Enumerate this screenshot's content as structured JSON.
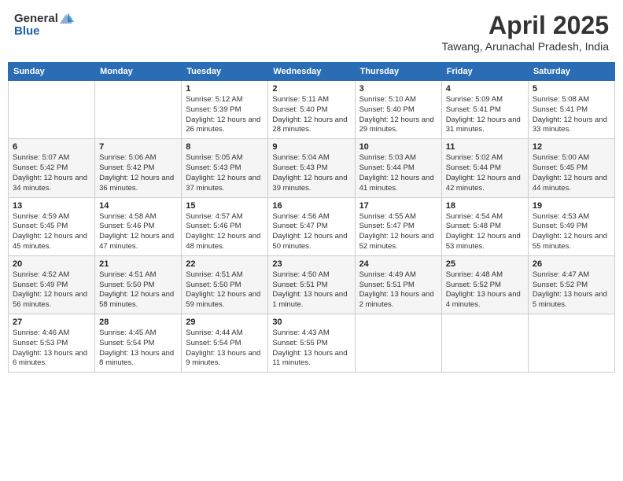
{
  "header": {
    "logo_general": "General",
    "logo_blue": "Blue",
    "title_month": "April 2025",
    "title_location": "Tawang, Arunachal Pradesh, India"
  },
  "weekdays": [
    "Sunday",
    "Monday",
    "Tuesday",
    "Wednesday",
    "Thursday",
    "Friday",
    "Saturday"
  ],
  "weeks": [
    [
      {
        "day": "",
        "sunrise": "",
        "sunset": "",
        "daylight": ""
      },
      {
        "day": "",
        "sunrise": "",
        "sunset": "",
        "daylight": ""
      },
      {
        "day": "1",
        "sunrise": "Sunrise: 5:12 AM",
        "sunset": "Sunset: 5:39 PM",
        "daylight": "Daylight: 12 hours and 26 minutes."
      },
      {
        "day": "2",
        "sunrise": "Sunrise: 5:11 AM",
        "sunset": "Sunset: 5:40 PM",
        "daylight": "Daylight: 12 hours and 28 minutes."
      },
      {
        "day": "3",
        "sunrise": "Sunrise: 5:10 AM",
        "sunset": "Sunset: 5:40 PM",
        "daylight": "Daylight: 12 hours and 29 minutes."
      },
      {
        "day": "4",
        "sunrise": "Sunrise: 5:09 AM",
        "sunset": "Sunset: 5:41 PM",
        "daylight": "Daylight: 12 hours and 31 minutes."
      },
      {
        "day": "5",
        "sunrise": "Sunrise: 5:08 AM",
        "sunset": "Sunset: 5:41 PM",
        "daylight": "Daylight: 12 hours and 33 minutes."
      }
    ],
    [
      {
        "day": "6",
        "sunrise": "Sunrise: 5:07 AM",
        "sunset": "Sunset: 5:42 PM",
        "daylight": "Daylight: 12 hours and 34 minutes."
      },
      {
        "day": "7",
        "sunrise": "Sunrise: 5:06 AM",
        "sunset": "Sunset: 5:42 PM",
        "daylight": "Daylight: 12 hours and 36 minutes."
      },
      {
        "day": "8",
        "sunrise": "Sunrise: 5:05 AM",
        "sunset": "Sunset: 5:43 PM",
        "daylight": "Daylight: 12 hours and 37 minutes."
      },
      {
        "day": "9",
        "sunrise": "Sunrise: 5:04 AM",
        "sunset": "Sunset: 5:43 PM",
        "daylight": "Daylight: 12 hours and 39 minutes."
      },
      {
        "day": "10",
        "sunrise": "Sunrise: 5:03 AM",
        "sunset": "Sunset: 5:44 PM",
        "daylight": "Daylight: 12 hours and 41 minutes."
      },
      {
        "day": "11",
        "sunrise": "Sunrise: 5:02 AM",
        "sunset": "Sunset: 5:44 PM",
        "daylight": "Daylight: 12 hours and 42 minutes."
      },
      {
        "day": "12",
        "sunrise": "Sunrise: 5:00 AM",
        "sunset": "Sunset: 5:45 PM",
        "daylight": "Daylight: 12 hours and 44 minutes."
      }
    ],
    [
      {
        "day": "13",
        "sunrise": "Sunrise: 4:59 AM",
        "sunset": "Sunset: 5:45 PM",
        "daylight": "Daylight: 12 hours and 45 minutes."
      },
      {
        "day": "14",
        "sunrise": "Sunrise: 4:58 AM",
        "sunset": "Sunset: 5:46 PM",
        "daylight": "Daylight: 12 hours and 47 minutes."
      },
      {
        "day": "15",
        "sunrise": "Sunrise: 4:57 AM",
        "sunset": "Sunset: 5:46 PM",
        "daylight": "Daylight: 12 hours and 48 minutes."
      },
      {
        "day": "16",
        "sunrise": "Sunrise: 4:56 AM",
        "sunset": "Sunset: 5:47 PM",
        "daylight": "Daylight: 12 hours and 50 minutes."
      },
      {
        "day": "17",
        "sunrise": "Sunrise: 4:55 AM",
        "sunset": "Sunset: 5:47 PM",
        "daylight": "Daylight: 12 hours and 52 minutes."
      },
      {
        "day": "18",
        "sunrise": "Sunrise: 4:54 AM",
        "sunset": "Sunset: 5:48 PM",
        "daylight": "Daylight: 12 hours and 53 minutes."
      },
      {
        "day": "19",
        "sunrise": "Sunrise: 4:53 AM",
        "sunset": "Sunset: 5:49 PM",
        "daylight": "Daylight: 12 hours and 55 minutes."
      }
    ],
    [
      {
        "day": "20",
        "sunrise": "Sunrise: 4:52 AM",
        "sunset": "Sunset: 5:49 PM",
        "daylight": "Daylight: 12 hours and 56 minutes."
      },
      {
        "day": "21",
        "sunrise": "Sunrise: 4:51 AM",
        "sunset": "Sunset: 5:50 PM",
        "daylight": "Daylight: 12 hours and 58 minutes."
      },
      {
        "day": "22",
        "sunrise": "Sunrise: 4:51 AM",
        "sunset": "Sunset: 5:50 PM",
        "daylight": "Daylight: 12 hours and 59 minutes."
      },
      {
        "day": "23",
        "sunrise": "Sunrise: 4:50 AM",
        "sunset": "Sunset: 5:51 PM",
        "daylight": "Daylight: 13 hours and 1 minute."
      },
      {
        "day": "24",
        "sunrise": "Sunrise: 4:49 AM",
        "sunset": "Sunset: 5:51 PM",
        "daylight": "Daylight: 13 hours and 2 minutes."
      },
      {
        "day": "25",
        "sunrise": "Sunrise: 4:48 AM",
        "sunset": "Sunset: 5:52 PM",
        "daylight": "Daylight: 13 hours and 4 minutes."
      },
      {
        "day": "26",
        "sunrise": "Sunrise: 4:47 AM",
        "sunset": "Sunset: 5:52 PM",
        "daylight": "Daylight: 13 hours and 5 minutes."
      }
    ],
    [
      {
        "day": "27",
        "sunrise": "Sunrise: 4:46 AM",
        "sunset": "Sunset: 5:53 PM",
        "daylight": "Daylight: 13 hours and 6 minutes."
      },
      {
        "day": "28",
        "sunrise": "Sunrise: 4:45 AM",
        "sunset": "Sunset: 5:54 PM",
        "daylight": "Daylight: 13 hours and 8 minutes."
      },
      {
        "day": "29",
        "sunrise": "Sunrise: 4:44 AM",
        "sunset": "Sunset: 5:54 PM",
        "daylight": "Daylight: 13 hours and 9 minutes."
      },
      {
        "day": "30",
        "sunrise": "Sunrise: 4:43 AM",
        "sunset": "Sunset: 5:55 PM",
        "daylight": "Daylight: 13 hours and 11 minutes."
      },
      {
        "day": "",
        "sunrise": "",
        "sunset": "",
        "daylight": ""
      },
      {
        "day": "",
        "sunrise": "",
        "sunset": "",
        "daylight": ""
      },
      {
        "day": "",
        "sunrise": "",
        "sunset": "",
        "daylight": ""
      }
    ]
  ]
}
